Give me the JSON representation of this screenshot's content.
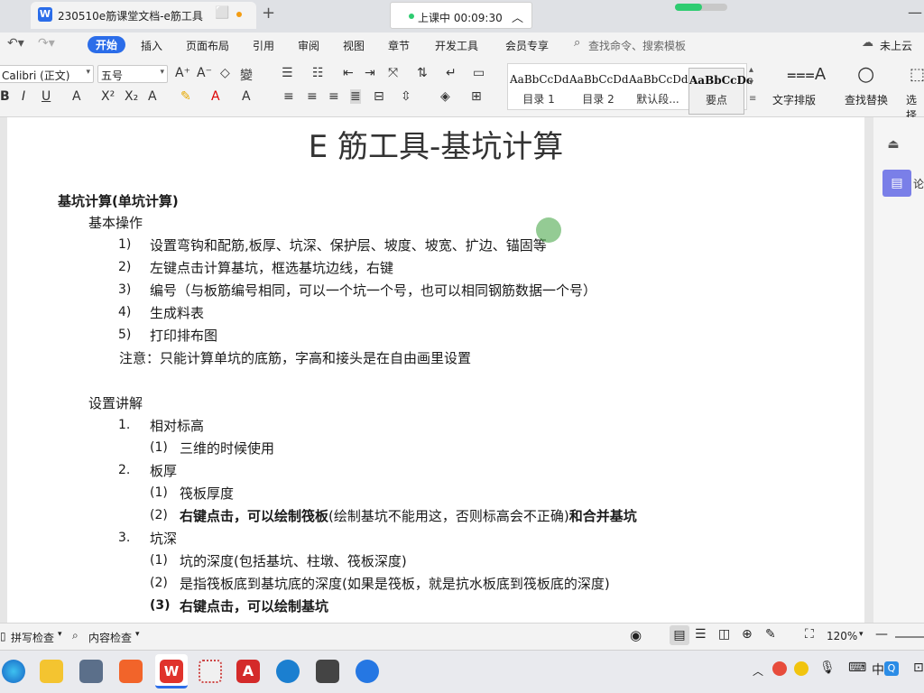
{
  "window": {
    "tab_title": "230510e筋课堂文档-e筋工具",
    "live_status": "上课中 00:09:30",
    "new_tab": "+"
  },
  "menu": {
    "items": [
      "开始",
      "插入",
      "页面布局",
      "引用",
      "审阅",
      "视图",
      "章节",
      "开发工具",
      "会员专享"
    ],
    "search_placeholder": "查找命令、搜索模板",
    "cloud": "未上云"
  },
  "ribbon": {
    "font_name": "Calibri (正文)",
    "font_size": "五号",
    "styles": [
      {
        "preview": "AaBbCcDd",
        "name": "目录 1"
      },
      {
        "preview": "AaBbCcDd",
        "name": "目录 2"
      },
      {
        "preview": "AaBbCcDd",
        "name": "默认段..."
      },
      {
        "preview": "AaBbCcDc",
        "name": "要点"
      }
    ],
    "text_layout": "文字排版",
    "find_replace": "查找替换",
    "select": "选择"
  },
  "document": {
    "title": "E 筋工具-基坑计算",
    "heading": "基坑计算(单坑计算)",
    "section1": "基本操作",
    "basic_steps": [
      {
        "num": "1)",
        "text": "设置弯钩和配筋,板厚、坑深、保护层、坡度、坡宽、扩边、锚固等"
      },
      {
        "num": "2)",
        "text": "左键点击计算基坑，框选基坑边线，右键"
      },
      {
        "num": "3)",
        "text": "编号（与板筋编号相同，可以一个坑一个号，也可以相同钢筋数据一个号）"
      },
      {
        "num": "4)",
        "text": "生成料表"
      },
      {
        "num": "5)",
        "text": "打印排布图"
      }
    ],
    "note": "注意：只能计算单坑的底筋，字高和接头是在自由画里设置",
    "section2": "设置讲解",
    "items": [
      {
        "num": "1.",
        "text": "相对标高",
        "subs": [
          {
            "num": "(1)",
            "text": "三维的时候使用"
          }
        ]
      },
      {
        "num": "2.",
        "text": "板厚",
        "subs": [
          {
            "num": "(1)",
            "text": "筏板厚度"
          },
          {
            "num": "(2)",
            "bold1": "右键点击，可以绘制筏板",
            "normal": "(绘制基坑不能用这，否则标高会不正确)",
            "bold2": "和合并基坑"
          }
        ]
      },
      {
        "num": "3.",
        "text": "坑深",
        "subs": [
          {
            "num": "(1)",
            "text": "坑的深度(包括基坑、柱墩、筏板深度)"
          },
          {
            "num": "(2)",
            "text": "是指筏板底到基坑底的深度(如果是筏板，就是抗水板底到筏板底的深度)"
          },
          {
            "num": "(3)",
            "bold": "右键点击，可以绘制基坑"
          }
        ]
      }
    ]
  },
  "right_panel": {
    "label": "论"
  },
  "status": {
    "spell_check": "拼写检查",
    "content_check": "内容检查",
    "zoom": "120%"
  }
}
